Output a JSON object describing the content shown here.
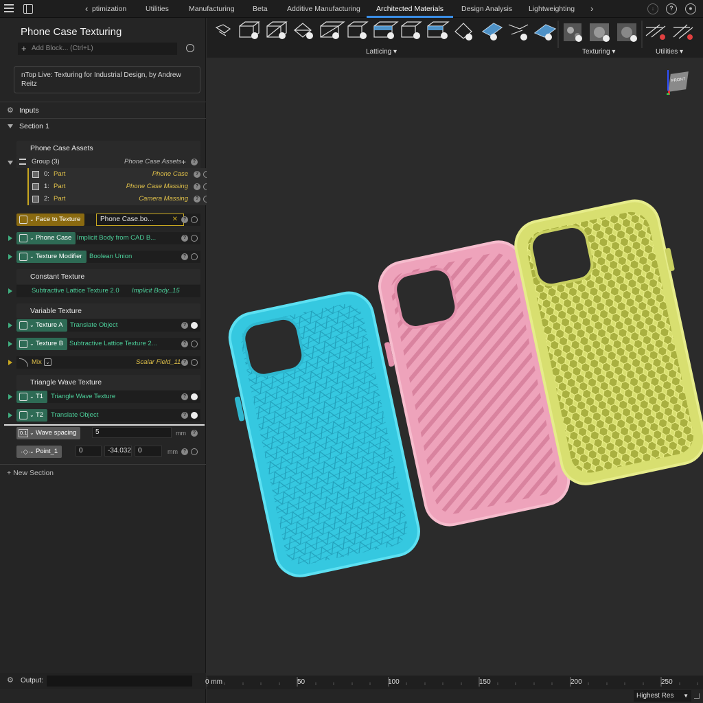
{
  "topbar": {
    "tabs": [
      "ptimization",
      "Utilities",
      "Manufacturing",
      "Beta",
      "Additive Manufacturing",
      "Architected Materials",
      "Design Analysis",
      "Lightweighting"
    ],
    "active_tab": "Architected Materials"
  },
  "ribbon": {
    "groups": [
      "Latticing",
      "Texturing",
      "Utilities"
    ]
  },
  "panel": {
    "title": "Phone Case Texturing",
    "add_block_placeholder": "Add Block... (Ctrl+L)",
    "description": "nTop Live: Texturing for Industrial Design, by Andrew Reitz",
    "inputs_label": "Inputs",
    "section1_label": "Section 1",
    "assets_header": "Phone Case Assets",
    "group_label": "Group (3)",
    "group_value": "Phone Case Assets",
    "parts": [
      {
        "index": "0:",
        "type": "Part",
        "name": "Phone Case"
      },
      {
        "index": "1:",
        "type": "Part",
        "name": "Phone Case Massing"
      },
      {
        "index": "2:",
        "type": "Part",
        "name": "Camera Massing"
      }
    ],
    "face_to_texture": {
      "label": "Face to Texture",
      "value": "Phone Case.bo..."
    },
    "phone_case": {
      "label": "Phone Case",
      "value": "Implicit Body from CAD B..."
    },
    "texture_modifier": {
      "label": "Texture Modifier",
      "value": "Boolean Union"
    },
    "constant_header": "Constant Texture",
    "subtractive": {
      "label": "Subtractive Lattice Texture 2.0",
      "value": "Implicit Body_15"
    },
    "variable_header": "Variable Texture",
    "texture_a": {
      "label": "Texture A",
      "value": "Translate Object"
    },
    "texture_b": {
      "label": "Texture B",
      "value": "Subtractive Lattice Texture 2..."
    },
    "mix": {
      "label": "Mix",
      "value": "Scalar Field_11"
    },
    "triangle_header": "Triangle Wave Texture",
    "t1": {
      "label": "T1",
      "value": "Triangle Wave Texture"
    },
    "t2": {
      "label": "T2",
      "value": "Translate Object"
    },
    "wave_spacing": {
      "label": "Wave spacing",
      "value": "5",
      "unit": "mm",
      "icon": "0.1"
    },
    "point1": {
      "label": "Point_1",
      "x": "0",
      "y": "-34.032",
      "z": "0",
      "unit": "mm"
    },
    "new_section": "New Section",
    "output_label": "Output:"
  },
  "viewcube": {
    "label": "FRONT"
  },
  "ruler": {
    "labels": [
      "0 mm",
      "50",
      "100",
      "150",
      "200",
      "250"
    ]
  },
  "render_quality": "Highest Res",
  "colors": {
    "cyan_case": "#35c8e0",
    "pink_case": "#eea3bb",
    "yellow_case": "#d8df70",
    "accent": "#3a8ee6"
  }
}
